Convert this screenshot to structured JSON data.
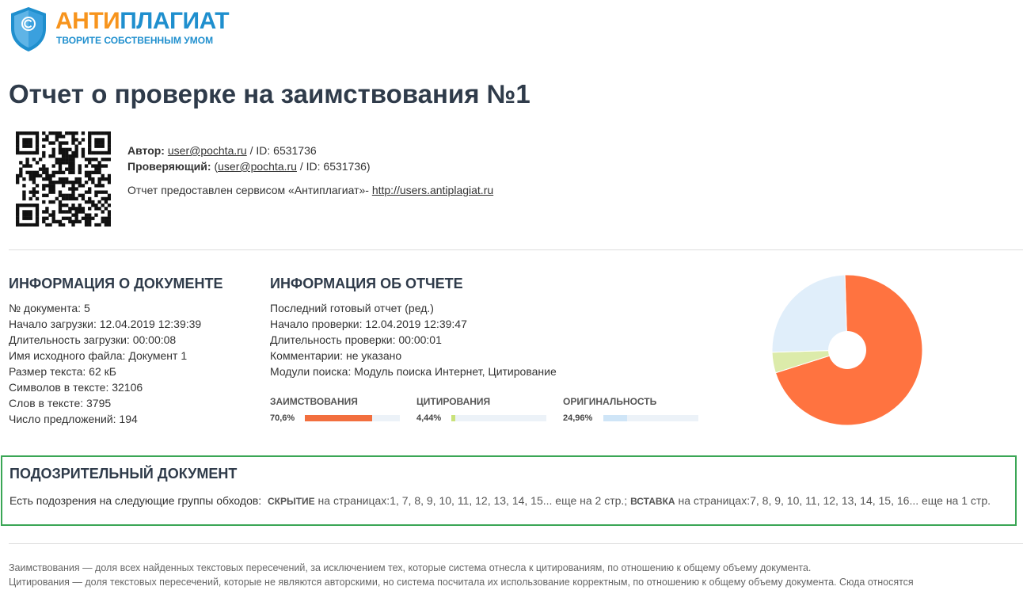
{
  "brand": {
    "name_part1": "АНТИ",
    "name_part2": "ПЛАГИАТ",
    "tagline": "ТВОРИТЕ СОБСТВЕННЫМ УМОМ",
    "colors": {
      "orange": "#f7941d",
      "blue": "#1f8fce"
    }
  },
  "report": {
    "title": "Отчет о проверке на заимствования №1"
  },
  "meta": {
    "author_label": "Автор:",
    "author_email": "user@pochta.ru",
    "author_id": " / ID: 6531736",
    "reviewer_label": "Проверяющий:",
    "reviewer_open": " (",
    "reviewer_email": "user@pochta.ru",
    "reviewer_id": " / ID: 6531736)",
    "service_text": "Отчет предоставлен сервисом «Антиплагиат»- ",
    "service_link": "http://users.antiplagiat.ru"
  },
  "doc_info": {
    "heading": "ИНФОРМАЦИЯ О ДОКУМЕНТЕ",
    "lines": [
      "№ документа: 5",
      "Начало загрузки: 12.04.2019 12:39:39",
      "Длительность загрузки: 00:00:08",
      "Имя исходного файла: Документ 1",
      "Размер текста: 62 кБ",
      "Символов в тексте: 32106",
      "Слов в тексте: 3795",
      "Число предложений: 194"
    ]
  },
  "report_info": {
    "heading": "ИНФОРМАЦИЯ ОБ ОТЧЕТЕ",
    "lines": [
      "Последний готовый отчет (ред.)",
      "Начало проверки: 12.04.2019 12:39:47",
      "Длительность проверки: 00:00:01",
      "Комментарии: не указано",
      "Модули поиска: Модуль поиска Интернет, Цитирование"
    ]
  },
  "metrics": [
    {
      "label": "ЗАИМСТВОВАНИЯ",
      "value_text": "70,6%",
      "fraction": 0.706,
      "color": "#f26f3e"
    },
    {
      "label": "ЦИТИРОВАНИЯ",
      "value_text": "4,44%",
      "fraction": 0.0444,
      "color": "#c9e27a"
    },
    {
      "label": "ОРИГИНАЛЬНОСТЬ",
      "value_text": "24,96%",
      "fraction": 0.2496,
      "color": "#cfe5f7"
    }
  ],
  "chart_data": {
    "type": "pie",
    "donut": true,
    "slices": [
      {
        "name": "ЗАИМСТВОВАНИЯ",
        "value": 70.6,
        "color": "#ff7340"
      },
      {
        "name": "ЦИТИРОВАНИЯ",
        "value": 4.44,
        "color": "#dcebaa"
      },
      {
        "name": "ОРИГИНАЛЬНОСТЬ",
        "value": 24.96,
        "color": "#e0eefa"
      }
    ]
  },
  "suspicious": {
    "heading": "ПОДОЗРИТЕЛЬНЫЙ ДОКУМЕНТ",
    "intro": "Есть подозрения на следующие группы обходов:",
    "tag1": "СКРЫТИЕ",
    "pages1": " на страницах:1, 7, 8, 9, 10, 11, 12, 13, 14, 15... еще на 2 стр.;",
    "tag2": "ВСТАВКА",
    "pages2": " на страницах:7, 8, 9, 10, 11, 12, 13, 14, 15, 16... еще на 1 стр."
  },
  "footer": {
    "line1": "Заимствования — доля всех найденных текстовых пересечений, за исключением тех, которые система отнесла к цитированиям, по отношению к общему объему документа.",
    "line2": "Цитирования — доля текстовых пересечений, которые не являются авторскими, но система посчитала их использование корректным, по отношению к общему объему документа. Сюда относятся"
  }
}
